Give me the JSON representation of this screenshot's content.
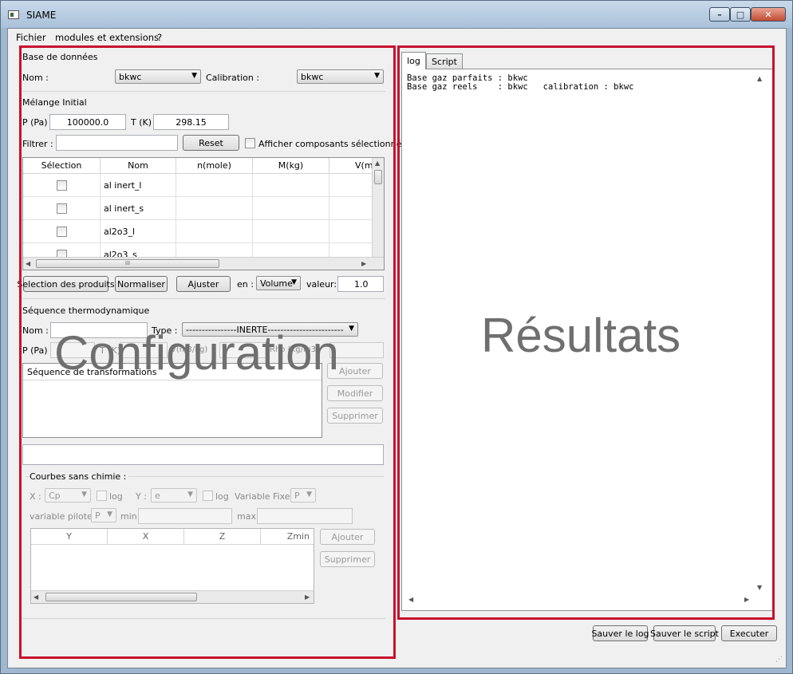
{
  "window": {
    "title": "SIAME",
    "controls": {
      "minimize": "–",
      "maximize": "□",
      "close": "✕"
    }
  },
  "menu": [
    "Fichier",
    "modules et extensions",
    "?"
  ],
  "database": {
    "group_title": "Base de données",
    "nom_label": "Nom :",
    "nom_value": "bkwc",
    "calibration_label": "Calibration :",
    "calibration_value": "bkwc"
  },
  "melange": {
    "group_title": "Mélange Initial",
    "p_label": "P (Pa)",
    "p_value": "100000.0",
    "t_label": "T (K)",
    "t_value": "298.15",
    "filter_label": "Filtrer :",
    "filter_value": "",
    "reset_label": "Reset",
    "show_selected_label": "Afficher composants sélectionnés",
    "table": {
      "columns": [
        "Sélection",
        "Nom",
        "n(mole)",
        "M(kg)",
        "V(m"
      ],
      "rows": [
        {
          "nom": "al inert_l"
        },
        {
          "nom": "al inert_s"
        },
        {
          "nom": "al2o3_l"
        },
        {
          "nom": "al2o3_s"
        }
      ],
      "hscroll_mark": "III"
    },
    "btn_selection": "Selection des produits",
    "btn_normaliser": "Normaliser",
    "btn_ajuster": "Ajuster",
    "en_label": "en :",
    "en_value": "Volume",
    "valeur_label": "valeur:",
    "valeur_value": "1.0"
  },
  "sequence": {
    "group_title": "Séquence thermodynamique",
    "nom_label": "Nom :",
    "nom_value": "",
    "type_label": "Type :",
    "type_value": "----------------INERTE------------------------",
    "p_label": "P (Pa)",
    "t_label": "T (K)",
    "v_label": "V(m3/kg)",
    "rho_label": "Rho (kg/m3)",
    "list_title": "Séquence de transformations",
    "btn_ajouter": "Ajouter",
    "btn_modifier": "Modifier",
    "btn_supprimer": "Supprimer"
  },
  "courbes": {
    "group_title": "Courbes sans chimie :",
    "x_label": "X :",
    "x_value": "Cp",
    "log1_label": "log",
    "y_label": "Y :",
    "y_value": "e",
    "log2_label": "log",
    "var_fixe_label": "Variable Fixe :",
    "var_fixe_value": "P",
    "var_pilote_label": "variable pilote :",
    "var_pilote_value": "P",
    "min_label": "min",
    "max_label": "max",
    "table_columns": [
      "Y",
      "X",
      "Z",
      "Zmin"
    ],
    "btn_ajouter": "Ajouter",
    "btn_supprimer": "Supprimer"
  },
  "results": {
    "tabs": [
      "log",
      "Script"
    ],
    "log_text": "Base gaz parfaits : bkwc\nBase gaz reels    : bkwc   calibration : bkwc"
  },
  "bottom_buttons": {
    "save_log": "Sauver le log",
    "save_script": "Sauver le script",
    "execute": "Executer"
  },
  "overlays": {
    "left": "Configuration",
    "right": "Résultats",
    "color": "#c8102e"
  }
}
